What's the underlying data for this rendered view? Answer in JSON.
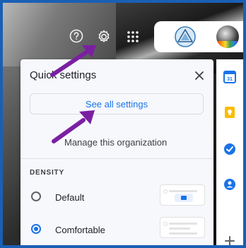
{
  "quick_settings": {
    "title": "Quick settings",
    "see_all_label": "See all settings",
    "manage_label": "Manage this organization",
    "density_label": "DENSITY",
    "options": [
      {
        "label": "Default",
        "selected": false
      },
      {
        "label": "Comfortable",
        "selected": true
      }
    ]
  },
  "topbar": {
    "icons": [
      "help-icon",
      "settings-icon",
      "apps-icon"
    ]
  },
  "side_rail": {
    "calendar_label": "31",
    "icons": [
      "calendar-icon",
      "keep-icon",
      "tasks-icon",
      "contacts-icon",
      "add-icon"
    ]
  },
  "colors": {
    "accent": "#1a73e8",
    "annotation_arrow": "#7b1fa2",
    "frame_border": "#1a5fb4"
  }
}
